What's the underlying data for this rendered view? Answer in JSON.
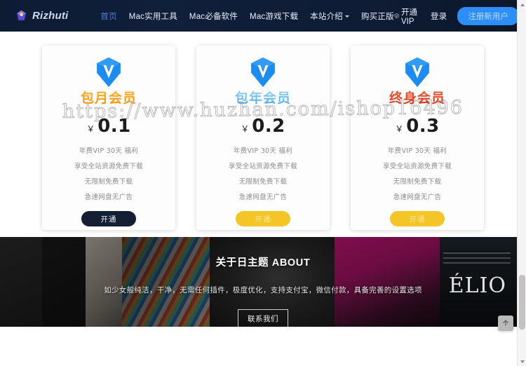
{
  "nav": {
    "logo_text": "Rizhuti",
    "logo_icon": "gem-icon",
    "menu": [
      {
        "label": "首页",
        "active": true,
        "has_caret": false
      },
      {
        "label": "Mac实用工具",
        "active": false,
        "has_caret": false
      },
      {
        "label": "Mac必备软件",
        "active": false,
        "has_caret": false
      },
      {
        "label": "Mac游戏下载",
        "active": false,
        "has_caret": false
      },
      {
        "label": "本站介绍",
        "active": false,
        "has_caret": true
      },
      {
        "label": "购买正版",
        "active": false,
        "has_caret": false
      }
    ],
    "vip_label": "开通VIP",
    "vip_icon": "shield-vip-icon",
    "login_label": "登录",
    "register_label": "注册新用户",
    "search_icon": "search-icon",
    "register_bg": "#2e8ef7"
  },
  "pricing": {
    "cards": [
      {
        "badge_icon": "v-badge-icon",
        "title": "包月会员",
        "title_color": "#f0a024",
        "currency": "￥",
        "amount": "0.1",
        "features": [
          "年费VIP 30天 福利",
          "享受全站资源免费下载",
          "无限制免费下载",
          "急速网盘无广告"
        ],
        "cta_label": "开通",
        "cta_style": "dark",
        "cta_bg": "#141f33"
      },
      {
        "badge_icon": "v-badge-icon",
        "title": "包年会员",
        "title_color": "#5cb4e8",
        "currency": "￥",
        "amount": "0.2",
        "features": [
          "年费VIP 30天 福利",
          "享受全站资源免费下载",
          "无限制免费下载",
          "急速网盘无广告"
        ],
        "cta_label": "开通",
        "cta_style": "gold",
        "cta_bg": "#f3c527"
      },
      {
        "badge_icon": "v-badge-icon",
        "title": "终身会员",
        "title_color": "#e0381c",
        "currency": "￥",
        "amount": "0.3",
        "features": [
          "年费VIP 30天 福利",
          "享受全站资源免费下载",
          "无限制免费下载",
          "急速网盘无广告"
        ],
        "cta_label": "开通",
        "cta_style": "gold",
        "cta_bg": "#f3c527"
      }
    ],
    "watermark": "https://www.huzhan.com/ishop16496"
  },
  "about": {
    "title": "关于日主题 ABOUT",
    "description": "如少女般纯洁，干净，无需任何插件，极度优化，支持支付宝，微信付款，具备完善的设置选项",
    "button_label": "联系我们",
    "poster_text": "ÉLIO"
  },
  "footer": {
    "back_to_top_icon": "arrow-up-icon"
  },
  "scrollbar": {
    "up_icon": "chevron-up-icon",
    "down_icon": "chevron-down-icon"
  }
}
